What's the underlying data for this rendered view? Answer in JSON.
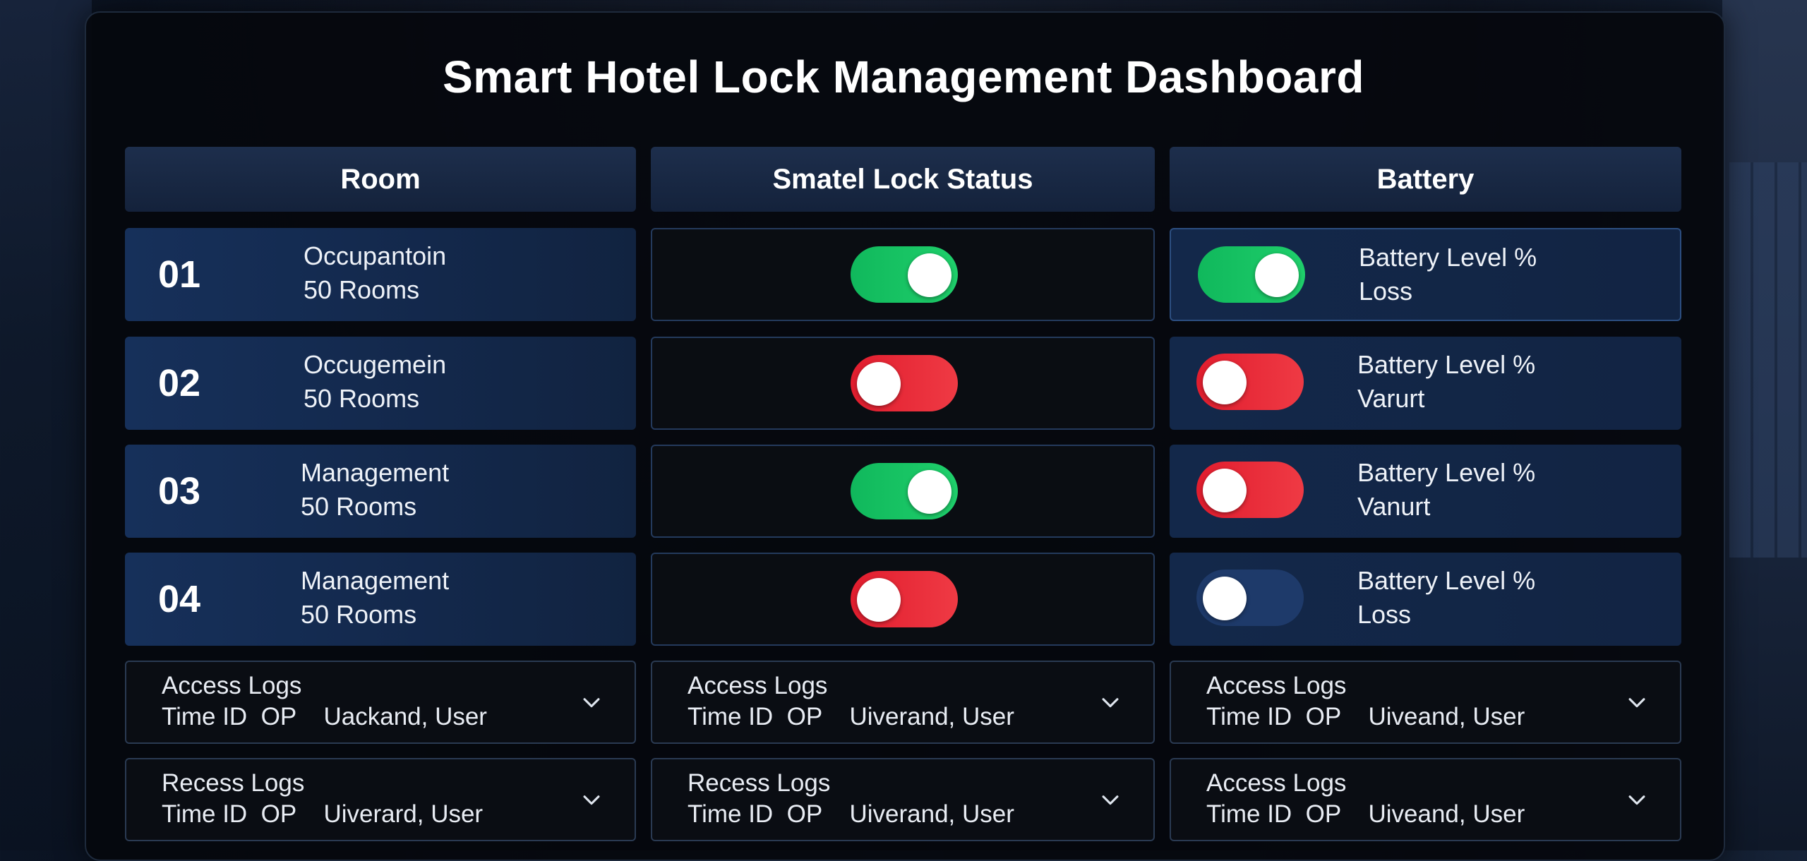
{
  "title": "Smart Hotel Lock Management Dashboard",
  "headers": {
    "room": "Room",
    "lock": "Smatel Lock Status",
    "battery": "Battery"
  },
  "rows": [
    {
      "num": "01",
      "line1": "Occupantoin",
      "line2": "50 Rooms",
      "lock": "on",
      "lock_color": "#1fcf6b",
      "battery_toggle": "on",
      "battery_color": "#1fcf6b",
      "battery_line1": "Battery Level %",
      "battery_line2": "Loss"
    },
    {
      "num": "02",
      "line1": "Occugemein",
      "line2": "50 Rooms",
      "lock": "off",
      "lock_color": "#ef3a44",
      "battery_toggle": "off",
      "battery_color": "#ef3a44",
      "battery_line1": "Battery Level %",
      "battery_line2": "Varurt"
    },
    {
      "num": "03",
      "line1": "Management",
      "line2": "50 Rooms",
      "lock": "on",
      "lock_color": "#1fcf6b",
      "battery_toggle": "off",
      "battery_color": "#ef3a44",
      "battery_line1": "Battery Level %",
      "battery_line2": "Vanurt"
    },
    {
      "num": "04",
      "line1": "Management",
      "line2": "50 Rooms",
      "lock": "off",
      "lock_color": "#ef3a44",
      "battery_toggle": "off",
      "battery_color": "#1e3a6a",
      "battery_line1": "Battery Level %",
      "battery_line2": "Loss"
    }
  ],
  "logs": [
    [
      {
        "title": "Access Logs",
        "line2": "Time ID  OP    Uackand, User"
      },
      {
        "title": "Access Logs",
        "line2": "Time ID  OP    Uiverand, User"
      },
      {
        "title": "Access Logs",
        "line2": "Time ID  OP    Uiveand, User"
      }
    ],
    [
      {
        "title": "Recess Logs",
        "line2": "Time ID  OP    Uiverard, User"
      },
      {
        "title": "Recess Logs",
        "line2": "Time ID  OP    Uiverand, User"
      },
      {
        "title": "Access Logs",
        "line2": "Time ID  OP    Uiveand, User"
      }
    ]
  ],
  "icons": {
    "log_expand": "chevron-down-icon"
  }
}
